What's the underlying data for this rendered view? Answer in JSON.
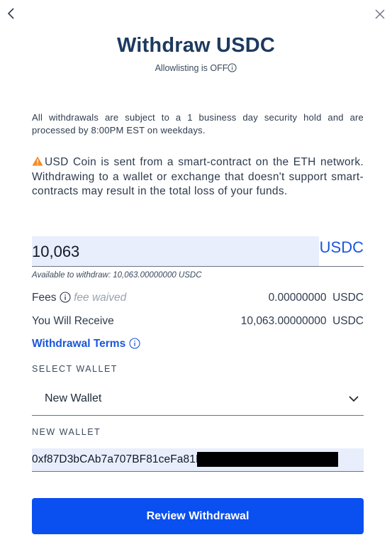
{
  "header": {
    "title": "Withdraw USDC",
    "allowlisting_label": "Allowlisting is",
    "allowlisting_status": "OFF",
    "back_icon": "chevron-left-icon",
    "close_icon": "close-icon"
  },
  "notices": {
    "hold_text": "All withdrawals are subject to a 1 business day security hold and are processed by 8:00PM EST on weekdays.",
    "warning_text": "USD Coin is sent from a smart-contract on the ETH network. Withdrawing to a wallet or exchange that doesn't support smart-contracts may result in the total loss of your funds.",
    "warning_icon": "warning-triangle-icon"
  },
  "amount": {
    "value": "10,063",
    "unit": "USDC",
    "available": "Available to withdraw: 10,063.00000000 USDC"
  },
  "fees": {
    "label": "Fees",
    "note": "fee waived",
    "value": "0.00000000",
    "unit": "USDC"
  },
  "receive": {
    "label": "You Will Receive",
    "value": "10,063.00000000",
    "unit": "USDC"
  },
  "terms": {
    "label": "Withdrawal Terms"
  },
  "wallet": {
    "select_label": "SELECT WALLET",
    "selected": "New Wallet",
    "new_wallet_label": "NEW WALLET",
    "address": "0xf87D3bCAb7a707BF81ceFa81E"
  },
  "actions": {
    "review_label": "Review Withdrawal"
  },
  "colors": {
    "accent": "#0a4ff0",
    "link": "#1a56db",
    "title": "#1d3a5f",
    "input_bg": "#e8eefb",
    "warning": "#f28c28"
  }
}
